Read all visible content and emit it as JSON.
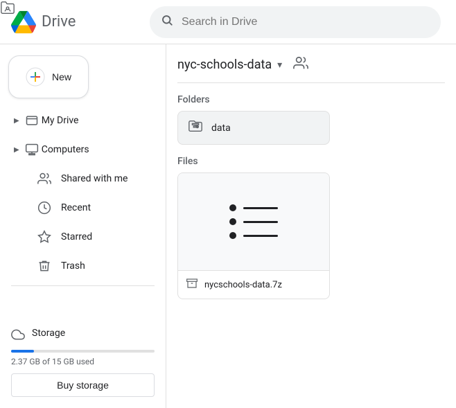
{
  "app": {
    "title": "Drive",
    "logo_alt": "Google Drive logo"
  },
  "search": {
    "placeholder": "Search in Drive"
  },
  "new_button": {
    "label": "New"
  },
  "sidebar": {
    "items": [
      {
        "id": "my-drive",
        "label": "My Drive",
        "icon": "drive",
        "expandable": true
      },
      {
        "id": "computers",
        "label": "Computers",
        "icon": "computer",
        "expandable": true
      },
      {
        "id": "shared-with-me",
        "label": "Shared with me",
        "icon": "people"
      },
      {
        "id": "recent",
        "label": "Recent",
        "icon": "clock"
      },
      {
        "id": "starred",
        "label": "Starred",
        "icon": "star"
      },
      {
        "id": "trash",
        "label": "Trash",
        "icon": "trash"
      }
    ],
    "storage": {
      "label": "Storage",
      "used_text": "2.37 GB of 15 GB used",
      "fill_percent": 16,
      "buy_label": "Buy storage"
    }
  },
  "content": {
    "breadcrumb": "nyc-schools-data",
    "sections": {
      "folders_label": "Folders",
      "files_label": "Files"
    },
    "folders": [
      {
        "name": "data",
        "icon": "folder-shared"
      }
    ],
    "files": [
      {
        "name": "nycschools-data.7z",
        "icon": "archive"
      }
    ]
  }
}
